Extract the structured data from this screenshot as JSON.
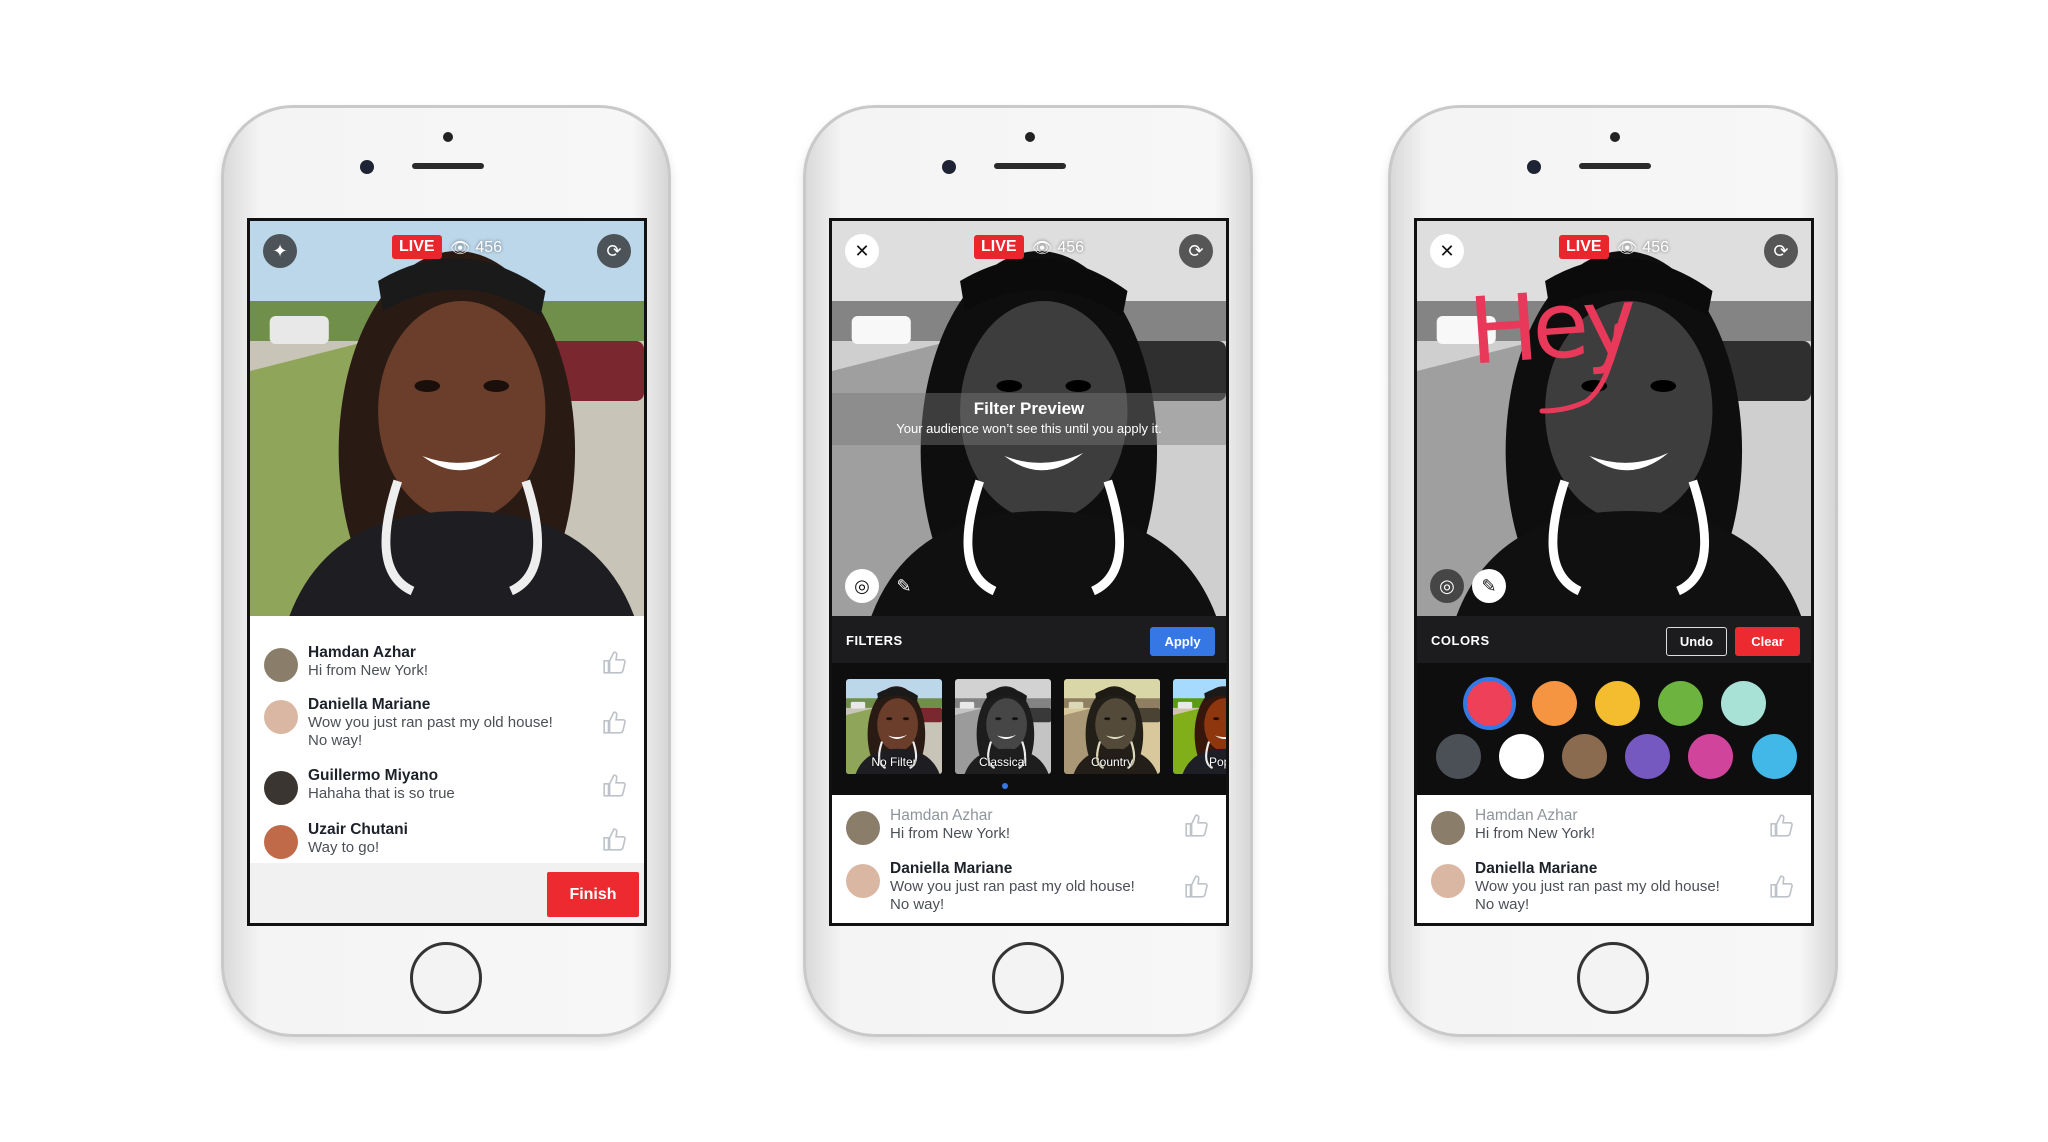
{
  "live_label": "LIVE",
  "viewer_count": "456",
  "icons": {
    "magic": "magic-wand-icon",
    "flip": "camera-flip-icon",
    "close": "close-icon",
    "filter": "aperture-icon",
    "pencil": "pencil-icon",
    "eye": "eye-icon",
    "like": "thumbs-up-icon"
  },
  "colors": {
    "live_red": "#e9262b",
    "apply_blue": "#3578e5",
    "clear_red": "#ec2a2f",
    "drawing": "#e8395a"
  },
  "phone1": {
    "comments": [
      {
        "name": "Hamdan Azhar",
        "message": "Hi from New York!"
      },
      {
        "name": "Daniella Mariane",
        "message": "Wow you just ran past my old house!",
        "message2": "No way!"
      },
      {
        "name": "Guillermo Miyano",
        "message": "Hahaha that is so true"
      },
      {
        "name": "Uzair Chutani",
        "message": "Way to go!"
      }
    ],
    "finish_label": "Finish"
  },
  "phone2": {
    "preview_title": "Filter Preview",
    "preview_subtitle": "Your audience won’t see this until you apply it.",
    "header_label": "FILTERS",
    "apply_label": "Apply",
    "filters": [
      "No Filter",
      "Classical",
      "Country",
      "Pop"
    ],
    "selected_filter": "Classical"
  },
  "phone3": {
    "header_label": "COLORS",
    "undo_label": "Undo",
    "clear_label": "Clear",
    "drawing_text": "Hey",
    "swatches_row1": [
      "#ee4058",
      "#f59542",
      "#f4bd2f",
      "#6db33f",
      "#a8e2d6"
    ],
    "swatches_row2": [
      "#4b4f56",
      "#ffffff",
      "#8b6b4f",
      "#7558c0",
      "#d0459b",
      "#41b8e8"
    ],
    "selected_swatch": "#ee4058"
  },
  "shared_comments": [
    {
      "name": "Hamdan Azhar",
      "message": "Hi from New York!"
    },
    {
      "name": "Daniella Mariane",
      "message": "Wow you just ran past my old house!",
      "message2": "No way!"
    }
  ]
}
